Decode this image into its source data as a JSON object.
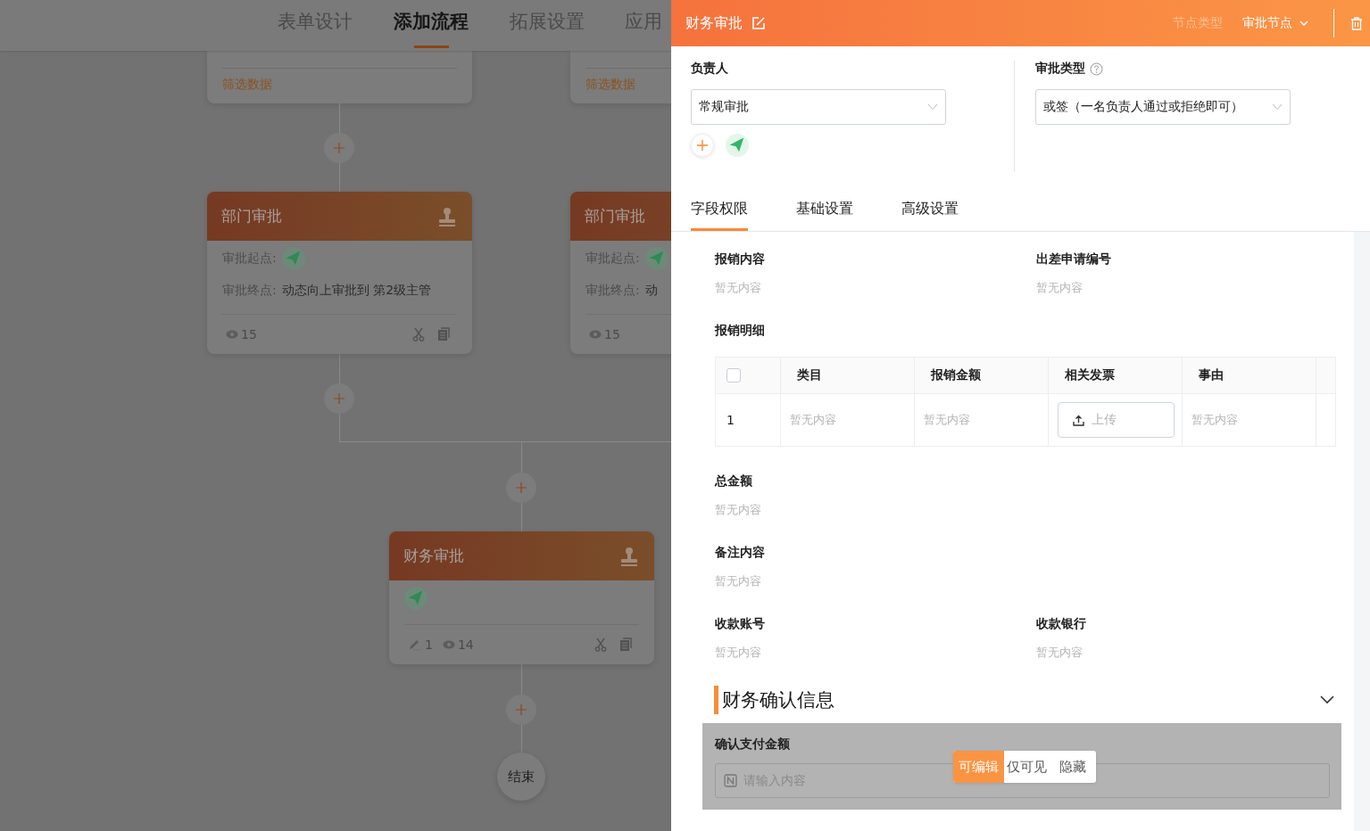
{
  "top_tabs": [
    {
      "label": "表单设计",
      "selected": false
    },
    {
      "label": "添加流程",
      "selected": true
    },
    {
      "label": "拓展设置",
      "selected": false
    },
    {
      "label": "应用",
      "selected": false
    }
  ],
  "flow": {
    "filter_cards": [
      {
        "link": "筛选数据"
      },
      {
        "link": "筛选数据"
      }
    ],
    "nodes": [
      {
        "kind": "department",
        "title": "部门审批",
        "start_label": "审批起点:",
        "end_label": "审批终点:",
        "end_value": "动态向上审批到 第2级主管",
        "views": "15"
      },
      {
        "kind": "department",
        "title": "部门审批",
        "start_label": "审批起点:",
        "end_label": "审批终点:",
        "end_value": "动",
        "views": "15"
      },
      {
        "kind": "finance",
        "title": "财务审批",
        "edits": "1",
        "views": "14"
      }
    ],
    "end": "结束"
  },
  "drawer": {
    "title": "财务审批",
    "node_type_label": "节点类型",
    "node_type": "审批节点",
    "assignee": {
      "label": "负责人",
      "value": "常规审批"
    },
    "approval_type": {
      "label": "审批类型",
      "value": "或签（一名负责人通过或拒绝即可）"
    },
    "tabs": [
      {
        "label": "字段权限",
        "selected": true
      },
      {
        "label": "基础设置",
        "selected": false
      },
      {
        "label": "高级设置",
        "selected": false
      }
    ],
    "fields": [
      {
        "kind": "text",
        "label": "报销内容",
        "value": "暂无内容",
        "full_row": false
      },
      {
        "kind": "text",
        "label": "出差申请编号",
        "value": "暂无内容",
        "full_row": false
      },
      {
        "kind": "table",
        "label": "报销明细",
        "checked": false,
        "columns": [
          "类目",
          "报销金额",
          "相关发票",
          "事由"
        ],
        "rows": [
          {
            "index": "1",
            "cells": [
              {
                "kind": "text",
                "value": "暂无内容"
              },
              {
                "kind": "text",
                "value": "暂无内容"
              },
              {
                "kind": "upload",
                "value": "上传"
              },
              {
                "kind": "text",
                "value": "暂无内容"
              }
            ]
          }
        ]
      },
      {
        "kind": "text",
        "label": "总金额",
        "value": "暂无内容",
        "full_row": true
      },
      {
        "kind": "text",
        "label": "备注内容",
        "value": "暂无内容",
        "full_row": true
      },
      {
        "kind": "text",
        "label": "收款账号",
        "value": "暂无内容",
        "full_row": false
      },
      {
        "kind": "text",
        "label": "收款银行",
        "value": "暂无内容",
        "full_row": false
      }
    ],
    "section": {
      "title": "财务确认信息",
      "expanded": true,
      "fields": [
        {
          "label": "确认支付金额",
          "placeholder": "请输入内容",
          "hovered": true,
          "permissions": [
            {
              "label": "可编辑",
              "selected": true
            },
            {
              "label": "仅可见",
              "selected": false
            },
            {
              "label": "隐藏",
              "selected": false
            }
          ]
        }
      ]
    }
  }
}
